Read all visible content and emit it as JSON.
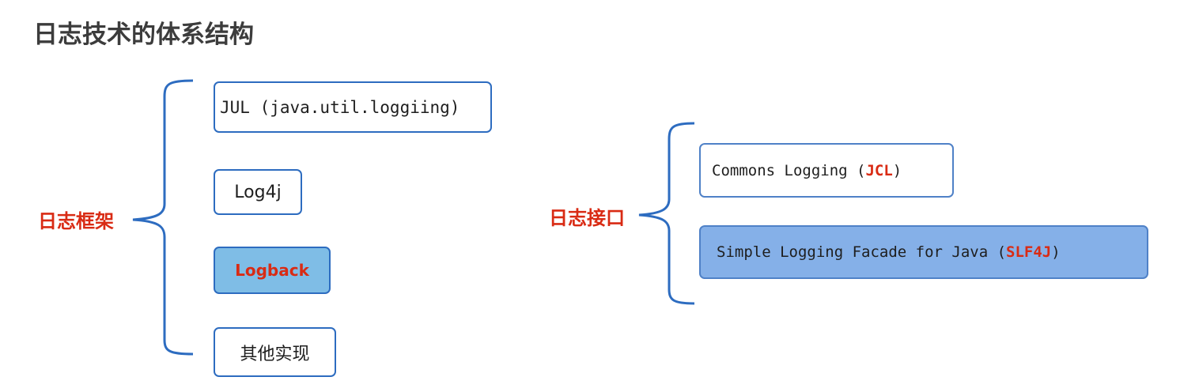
{
  "title": "日志技术的体系结构",
  "frameworks": {
    "label": "日志框架",
    "items": [
      "JUL (java.util.loggiing)",
      "Log4j",
      "Logback",
      "其他实现"
    ]
  },
  "interfaces": {
    "label": "日志接口",
    "items": [
      {
        "prefix": "Commons Logging (",
        "highlight": "JCL",
        "suffix": ")"
      },
      {
        "prefix": "Simple Logging Facade for Java (",
        "highlight": "SLF4J",
        "suffix": ")"
      }
    ]
  },
  "colors": {
    "accent_red": "#d92b14",
    "border_blue": "#2d6cc0",
    "fill_blue": "#85b0e8",
    "fill_teal": "#7fbde6"
  }
}
